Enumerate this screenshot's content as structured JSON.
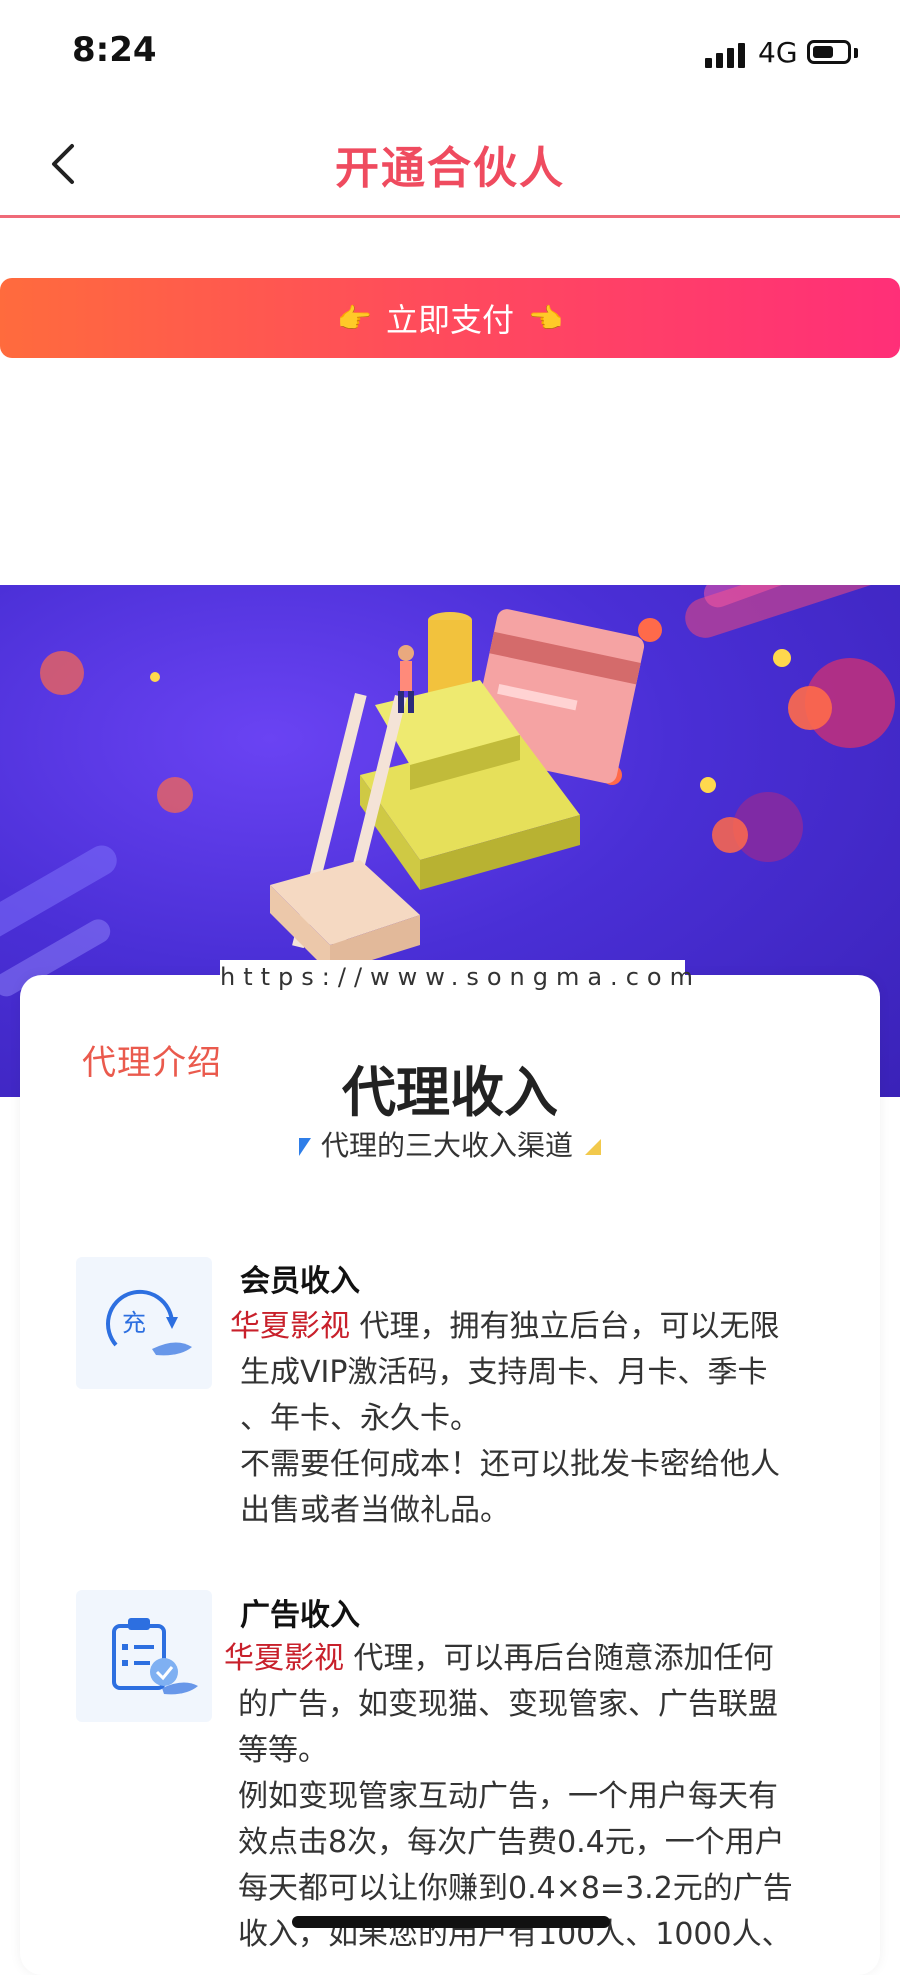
{
  "status": {
    "time": "8:24",
    "network": "4G"
  },
  "nav": {
    "title": "开通合伙人",
    "back_icon": "chevron-left-icon"
  },
  "pay_button": {
    "label": "立即支付",
    "left_icon": "👉",
    "right_icon": "👈"
  },
  "watermark": "https://www.songma.com",
  "card": {
    "tag": "代理介绍",
    "title": "代理收入",
    "subtitle": "代理的三大收入渠道"
  },
  "features": [
    {
      "icon": "recharge-icon",
      "icon_text": "充",
      "title": "会员收入",
      "brand": "华夏影视",
      "line1_rest": "代理，拥有独立后台，可以无限",
      "line2": "生成VIP激活码，支持周卡、月卡、季卡",
      "line3": "、年卡、永久卡。",
      "line4": "不需要任何成本！还可以批发卡密给他人",
      "line5": "出售或者当做礼品。"
    },
    {
      "icon": "ad-clipboard-icon",
      "title": "广告收入",
      "brand": "华夏影视",
      "line1_rest": "代理，可以再后台随意添加任何",
      "line2": "的广告，如变现猫、变现管家、广告联盟",
      "line3": "等等。",
      "line4": "例如变现管家互动广告，一个用户每天有",
      "line5": "效点击8次，每次广告费0.4元，一个用户",
      "line6": "每天都可以让你赚到0.4×8=3.2元的广告",
      "line7": "收入，如果您的用户有100人、1000人、"
    }
  ],
  "colors": {
    "accent": "#ef4b5f",
    "gradient_start": "#ff6b3d",
    "gradient_end": "#ff2f78",
    "banner": "#4a2fd6"
  }
}
